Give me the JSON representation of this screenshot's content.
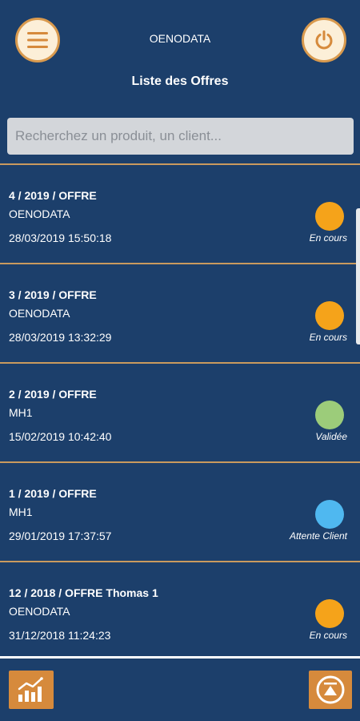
{
  "header": {
    "app_name": "OENODATA",
    "page_title": "Liste des Offres",
    "menu_icon": "hamburger-menu-icon",
    "power_icon": "power-icon"
  },
  "search": {
    "placeholder": "Recherchez un produit, un client..."
  },
  "offers": [
    {
      "ref": "4 / 2019 / OFFRE",
      "client": "OENODATA",
      "date": "28/03/2019 15:50:18",
      "status": "En cours",
      "status_color": "#f5a31a"
    },
    {
      "ref": "3 / 2019 / OFFRE",
      "client": "OENODATA",
      "date": "28/03/2019 13:32:29",
      "status": "En cours",
      "status_color": "#f5a31a"
    },
    {
      "ref": "2 / 2019 / OFFRE",
      "client": "MH1",
      "date": "15/02/2019 10:42:40",
      "status": "Validée",
      "status_color": "#9ccc7a"
    },
    {
      "ref": "1 / 2019 / OFFRE",
      "client": "MH1",
      "date": "29/01/2019 17:37:57",
      "status": "Attente Client",
      "status_color": "#4fb8f0"
    },
    {
      "ref": "12 / 2018 / OFFRE Thomas 1",
      "client": "OENODATA",
      "date": "31/12/2018 11:24:23",
      "status": "En cours",
      "status_color": "#f5a31a"
    }
  ],
  "footer": {
    "left_icon": "chart-icon",
    "right_icon": "scroll-top-icon"
  },
  "colors": {
    "background": "#1c3f6b",
    "accent": "#d68a3c",
    "separator": "#c99a5e"
  }
}
